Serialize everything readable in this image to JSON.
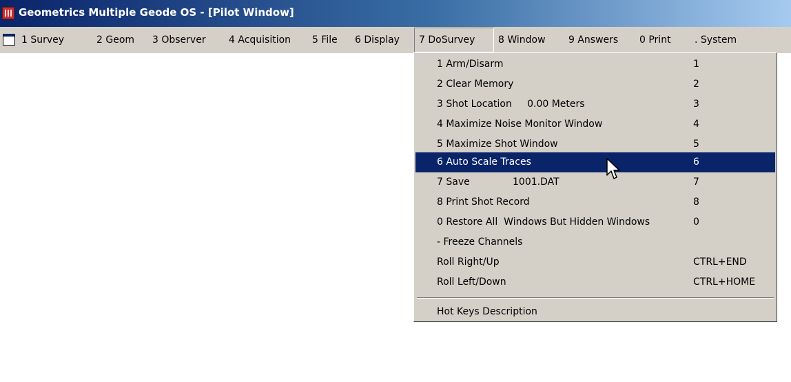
{
  "window": {
    "title": "Geometrics Multiple Geode OS - [Pilot Window]"
  },
  "menubar": {
    "items": [
      {
        "label": "1 Survey"
      },
      {
        "label": "2 Geom"
      },
      {
        "label": "3 Observer"
      },
      {
        "label": "4 Acquisition"
      },
      {
        "label": "5 File"
      },
      {
        "label": "6 Display"
      },
      {
        "label": "7 DoSurvey",
        "open": true
      },
      {
        "label": "8 Window"
      },
      {
        "label": "9 Answers"
      },
      {
        "label": "0 Print"
      },
      {
        "label": ". System"
      }
    ]
  },
  "dosurvey_menu": {
    "items": [
      {
        "label": "1 Arm/Disarm",
        "shortcut": "1"
      },
      {
        "label": "2 Clear Memory",
        "shortcut": "2"
      },
      {
        "label": "3 Shot Location     0.00 Meters",
        "shortcut": "3"
      },
      {
        "label": "4 Maximize Noise Monitor Window",
        "shortcut": "4"
      },
      {
        "label": "5 Maximize Shot Window",
        "shortcut": "5"
      },
      {
        "label": "6 Auto Scale Traces",
        "shortcut": "6",
        "highlighted": true
      },
      {
        "label": "7 Save              1001.DAT",
        "shortcut": "7"
      },
      {
        "label": "8 Print Shot Record",
        "shortcut": "8"
      },
      {
        "label": "0 Restore All  Windows But Hidden Windows",
        "shortcut": "0"
      },
      {
        "label": "- Freeze Channels",
        "shortcut": ""
      },
      {
        "label": "Roll Right/Up",
        "shortcut": "CTRL+END"
      },
      {
        "label": "Roll Left/Down",
        "shortcut": "CTRL+HOME"
      },
      {
        "label": "Hot Keys Description",
        "shortcut": ""
      }
    ]
  },
  "colors": {
    "highlight": "#0a246a",
    "menu_bg": "#d4d0c8"
  },
  "icons": {
    "app": "geode-app-icon",
    "document": "mdi-document-icon",
    "cursor": "mouse-pointer-icon"
  }
}
